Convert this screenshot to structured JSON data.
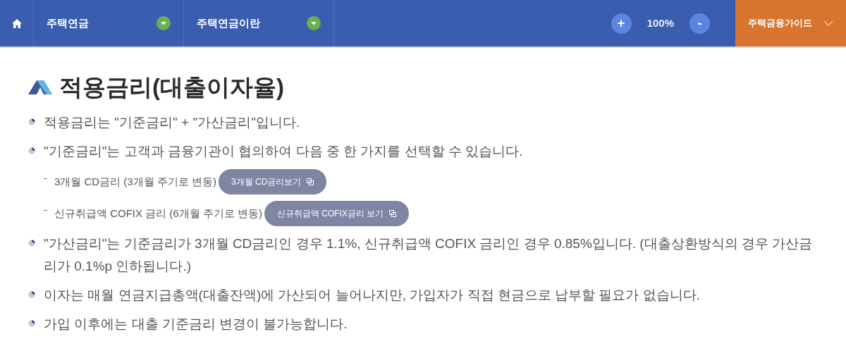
{
  "nav": {
    "tabs": [
      {
        "label": "주택연금"
      },
      {
        "label": "주택연금이란"
      }
    ],
    "zoom": {
      "plus": "+",
      "value": "100%",
      "minus": "-"
    },
    "guide": {
      "label": "주택금융가이드"
    }
  },
  "title": "적용금리(대출이자율)",
  "items": [
    {
      "kind": "bullet",
      "text": "적용금리는 \"기준금리\" + \"가산금리\"입니다."
    },
    {
      "kind": "bullet",
      "text": "\"기준금리\"는 고객과 금융기관이 협의하여 다음 중 한 가지를 선택할 수 있습니다."
    },
    {
      "kind": "sub",
      "text": "3개월 CD금리 (3개월 주기로 변동)",
      "button": "3개월 CD금리보기"
    },
    {
      "kind": "sub",
      "text": "신규취급액 COFIX 금리 (6개월 주기로 변동)",
      "button": "신규취급액 COFIX금리 보기"
    },
    {
      "kind": "bullet",
      "text": "\"가산금리\"는 기준금리가 3개월 CD금리인 경우 1.1%, 신규취급액 COFIX 금리인 경우 0.85%입니다. (대출상환방식의 경우 가산금리가 0.1%p 인하됩니다.)"
    },
    {
      "kind": "bullet",
      "text": "이자는 매월 연금지급총액(대출잔액)에 가산되어 늘어나지만, 가입자가 직접 현금으로 납부할 필요가 없습니다."
    },
    {
      "kind": "bullet",
      "text": "가입 이후에는 대출 기준금리 변경이 불가능합니다."
    }
  ]
}
